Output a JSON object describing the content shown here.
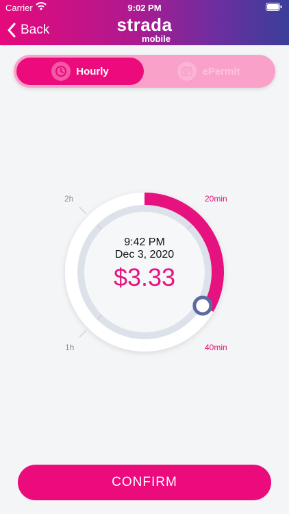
{
  "status_bar": {
    "carrier": "Carrier",
    "time": "9:02 PM"
  },
  "header": {
    "back_label": "Back",
    "logo_main": "strada",
    "logo_sub": "mobile",
    "gradient": [
      "#e5097c",
      "#6c2ea0",
      "#3a3f9a"
    ]
  },
  "tabs": [
    {
      "label": "Hourly",
      "icon": "clock-icon",
      "selected": true
    },
    {
      "label": "ePermit",
      "icon": "calendar-icon",
      "selected": false
    }
  ],
  "dial": {
    "labels": {
      "top_left": "2h",
      "top_right": "20min",
      "bottom_left": "1h",
      "bottom_right": "40min"
    },
    "end_time": "9:42 PM",
    "end_date": "Dec 3, 2020",
    "price": "$3.33",
    "selected_minutes": 40,
    "max_minutes": 120,
    "accent": "#e6127f",
    "handle_color": "#5b6aa0"
  },
  "confirm_label": "CONFIRM"
}
